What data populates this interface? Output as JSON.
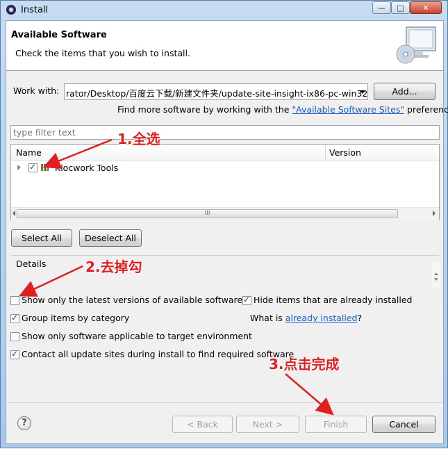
{
  "window": {
    "title": "Install",
    "controls": {
      "minimize": "—",
      "maximize": "□",
      "close": "✕"
    }
  },
  "header": {
    "title": "Available Software",
    "subtitle": "Check the items that you wish to install."
  },
  "work_with": {
    "label": "Work with:",
    "value": "rator/Desktop/百度云下载/新建文件夹/update-site-insight-ix86-pc-win32/",
    "add_button": "Add..."
  },
  "find_more": {
    "prefix": "Find more software by working with the ",
    "link": "\"Available Software Sites\"",
    "suffix": " preferences."
  },
  "filter": {
    "placeholder": "type filter text"
  },
  "tree": {
    "columns": [
      "Name",
      "Version"
    ],
    "rows": [
      {
        "label": "Klocwork Tools",
        "checked": true
      }
    ],
    "hscroll_grip": "III"
  },
  "select_all": "Select All",
  "deselect_all": "Deselect All",
  "details_label": "Details",
  "options": {
    "latest_versions": {
      "label": "Show only the latest versions of available software",
      "checked": false
    },
    "hide_installed": {
      "label": "Hide items that are already installed",
      "checked": true
    },
    "group_by_category": {
      "label": "Group items by category",
      "checked": true
    },
    "what_is": {
      "prefix": "What is ",
      "link": "already installed",
      "suffix": "?"
    },
    "target_env": {
      "label": "Show only software applicable to target environment",
      "checked": false
    },
    "contact_sites": {
      "label": "Contact all update sites during install to find required software",
      "checked": true
    }
  },
  "footer": {
    "help": "?",
    "back": "< Back",
    "next": "Next >",
    "finish": "Finish",
    "cancel": "Cancel"
  },
  "annotations": {
    "step1": "1.全选",
    "step2": "2.去掉勾",
    "step3": "3.点击完成",
    "color": "#e02020"
  }
}
